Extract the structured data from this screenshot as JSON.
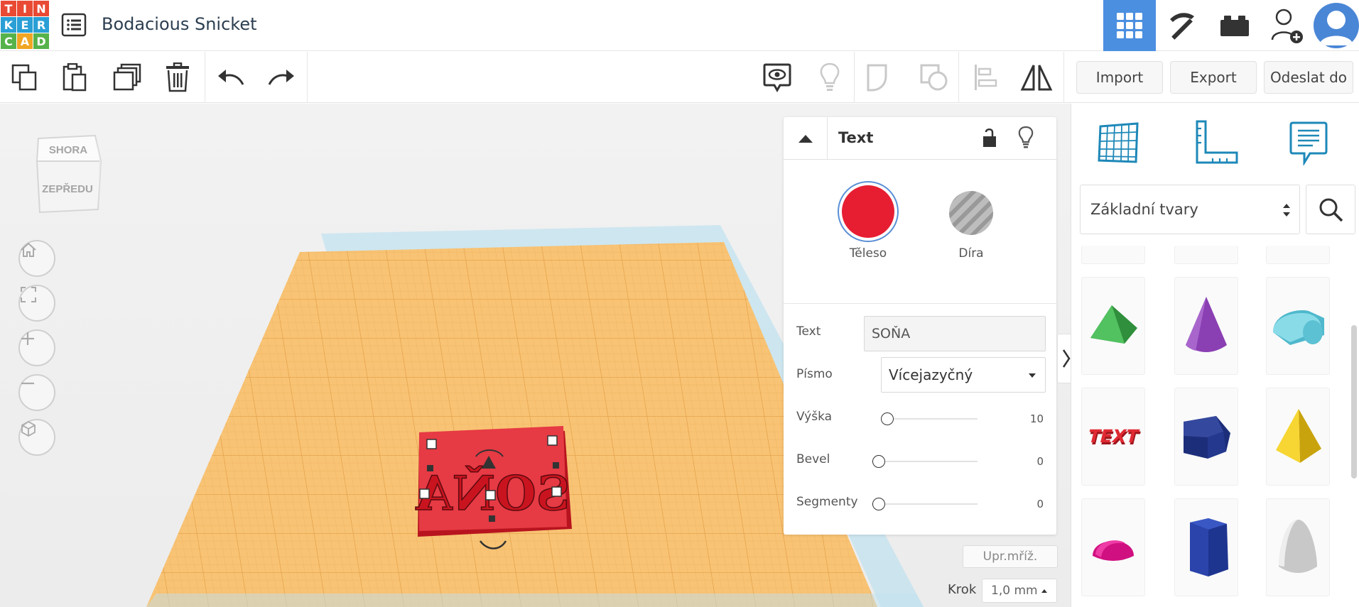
{
  "app": {
    "logo_letters": [
      "T",
      "I",
      "N",
      "K",
      "E",
      "R",
      "C",
      "A",
      "D"
    ],
    "logo_colors": [
      "#e94a34",
      "#e94a34",
      "#e94a34",
      "#2a9fd6",
      "#2a9fd6",
      "#2a9fd6",
      "#56b24a",
      "#f0a623",
      "#56b24a"
    ],
    "design_title": "Bodacious Snicket"
  },
  "toolbar": {
    "import_label": "Import",
    "export_label": "Export",
    "send_label": "Odeslat do"
  },
  "viewcube": {
    "top_label": "SHORA",
    "front_label": "ZEPŘEDU"
  },
  "inspector": {
    "title": "Text",
    "solid_label": "Těleso",
    "hole_label": "Díra",
    "solid_color": "#e71d32",
    "properties": {
      "text_label": "Text",
      "text_value": "SOŇA",
      "font_label": "Písmo",
      "font_value": "Vícejazyčný",
      "height_label": "Výška",
      "height_value": "10",
      "height_fraction": 0.0,
      "bevel_label": "Bevel",
      "bevel_value": "0",
      "bevel_fraction": 0.0,
      "segments_label": "Segmenty",
      "segments_value": "0",
      "segments_fraction": 0.0
    }
  },
  "workplane": {
    "object_text": "SOŇA",
    "grid_button": "Upr.mříž.",
    "snap_label": "Krok",
    "snap_value": "1,0 mm",
    "plane_color": "#f8c374"
  },
  "right_panel": {
    "category": "Základní tvary",
    "shapes": [
      {
        "name": "roof",
        "color": "#3aa34a"
      },
      {
        "name": "cone",
        "color": "#8a3fb3"
      },
      {
        "name": "half-cylinder",
        "color": "#6ecfe0"
      },
      {
        "name": "text",
        "color": "#d8232a"
      },
      {
        "name": "wedge",
        "color": "#2a3f9a"
      },
      {
        "name": "pyramid",
        "color": "#f2cb1d"
      },
      {
        "name": "half-sphere",
        "color": "#e0158a"
      },
      {
        "name": "polygon",
        "color": "#2c4aa8"
      },
      {
        "name": "paraboloid",
        "color": "#d4d4d4"
      }
    ]
  }
}
